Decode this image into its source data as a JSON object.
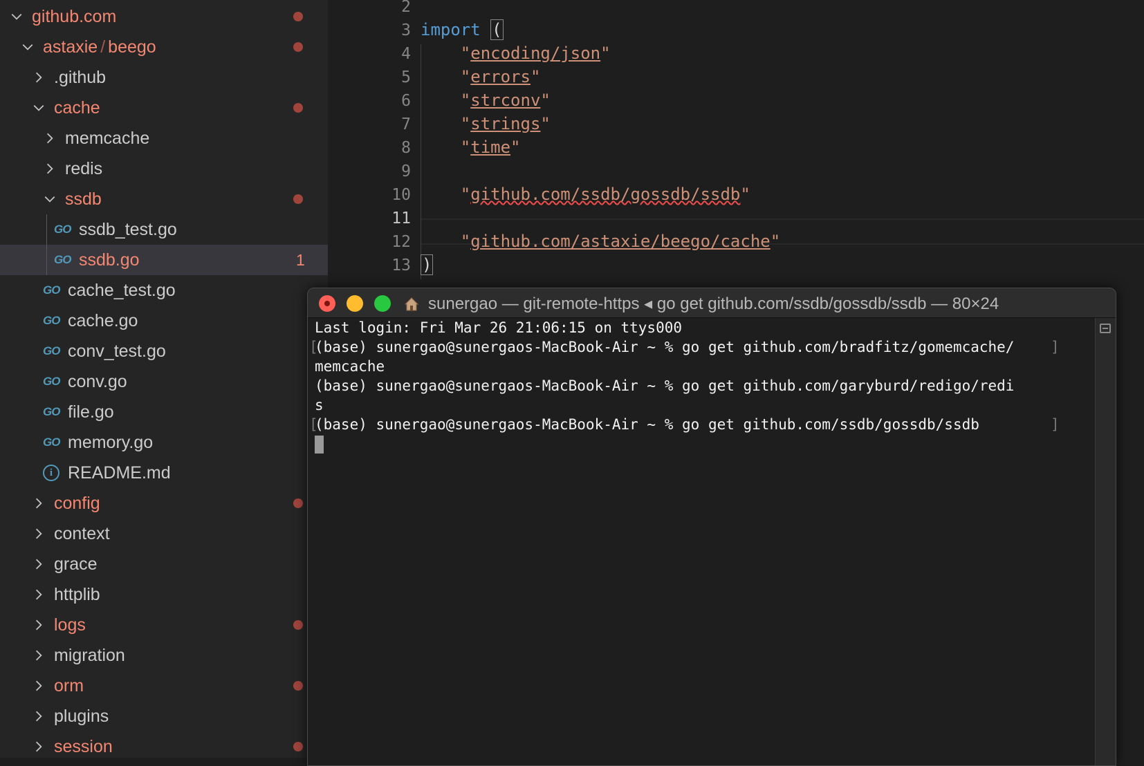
{
  "explorer": {
    "items": [
      {
        "label": "github.com",
        "kind": "folder",
        "expanded": true,
        "modified": true,
        "depth": 0
      },
      {
        "label": "astaxie",
        "label2": "beego",
        "kind": "folder",
        "expanded": true,
        "modified": true,
        "depth": 1
      },
      {
        "label": ".github",
        "kind": "folder",
        "expanded": false,
        "modified": false,
        "depth": 2
      },
      {
        "label": "cache",
        "kind": "folder",
        "expanded": true,
        "modified": true,
        "depth": 2
      },
      {
        "label": "memcache",
        "kind": "folder",
        "expanded": false,
        "modified": false,
        "depth": 3
      },
      {
        "label": "redis",
        "kind": "folder",
        "expanded": false,
        "modified": false,
        "depth": 3
      },
      {
        "label": "ssdb",
        "kind": "folder",
        "expanded": true,
        "modified": true,
        "depth": 3
      },
      {
        "label": "ssdb_test.go",
        "kind": "go",
        "modified": false,
        "depth": 4
      },
      {
        "label": "ssdb.go",
        "kind": "go",
        "modified": true,
        "selected": true,
        "problems": "1",
        "depth": 4
      },
      {
        "label": "cache_test.go",
        "kind": "go",
        "modified": false,
        "depth": 3
      },
      {
        "label": "cache.go",
        "kind": "go",
        "modified": false,
        "depth": 3
      },
      {
        "label": "conv_test.go",
        "kind": "go",
        "modified": false,
        "depth": 3
      },
      {
        "label": "conv.go",
        "kind": "go",
        "modified": false,
        "depth": 3
      },
      {
        "label": "file.go",
        "kind": "go",
        "modified": false,
        "depth": 3
      },
      {
        "label": "memory.go",
        "kind": "go",
        "modified": false,
        "depth": 3
      },
      {
        "label": "README.md",
        "kind": "info",
        "modified": false,
        "depth": 3
      },
      {
        "label": "config",
        "kind": "folder",
        "expanded": false,
        "modified": true,
        "depth": 2
      },
      {
        "label": "context",
        "kind": "folder",
        "expanded": false,
        "modified": false,
        "depth": 2
      },
      {
        "label": "grace",
        "kind": "folder",
        "expanded": false,
        "modified": false,
        "depth": 2
      },
      {
        "label": "httplib",
        "kind": "folder",
        "expanded": false,
        "modified": false,
        "depth": 2
      },
      {
        "label": "logs",
        "kind": "folder",
        "expanded": false,
        "modified": true,
        "depth": 2
      },
      {
        "label": "migration",
        "kind": "folder",
        "expanded": false,
        "modified": false,
        "depth": 2
      },
      {
        "label": "orm",
        "kind": "folder",
        "expanded": false,
        "modified": true,
        "depth": 2
      },
      {
        "label": "plugins",
        "kind": "folder",
        "expanded": false,
        "modified": false,
        "depth": 2
      },
      {
        "label": "session",
        "kind": "folder",
        "expanded": false,
        "modified": true,
        "depth": 2
      }
    ],
    "path_separator": "/",
    "go_icon_text": "GO",
    "info_icon_text": "i"
  },
  "editor": {
    "line_numbers": [
      "2",
      "3",
      "4",
      "5",
      "6",
      "7",
      "8",
      "9",
      "10",
      "11",
      "12",
      "13"
    ],
    "active_line": "11",
    "keyword_import": "import",
    "open_paren": "(",
    "close_paren": ")",
    "imports": [
      "encoding/json",
      "errors",
      "strconv",
      "strings",
      "time"
    ],
    "import_error": "github.com/ssdb/gossdb/ssdb",
    "import_local": "github.com/astaxie/beego/cache"
  },
  "terminal": {
    "title": "sunergao — git-remote-https ◂ go get github.com/ssdb/gossdb/ssdb — 80×24",
    "lines": [
      "Last login: Fri Mar 26 21:06:15 on ttys000",
      "(base) sunergao@sunergaos-MacBook-Air ~ % go get github.com/bradfitz/gomemcache/",
      "memcache",
      "(base) sunergao@sunergaos-MacBook-Air ~ % go get github.com/garyburd/redigo/redi",
      "s",
      "(base) sunergao@sunergaos-MacBook-Air ~ % go get github.com/ssdb/gossdb/ssdb"
    ],
    "mark_open": "[",
    "mark_close": "]"
  },
  "colors": {
    "modified": "#f48771",
    "keyword": "#569cd6",
    "string": "#ce9178",
    "go_icon": "#519aba"
  }
}
